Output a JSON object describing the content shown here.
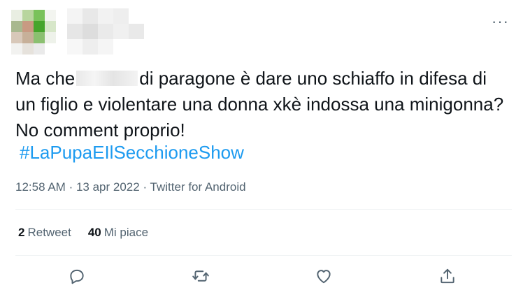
{
  "tweet": {
    "text_before": "Ma che",
    "text_after": "di paragone è dare uno schiaffo in difesa di un figlio e violentare una donna xkè indossa una minigonna? No comment proprio!",
    "hashtag": "#LaPupaEIlSecchioneShow",
    "time": "12:58 AM",
    "date": "13 apr 2022",
    "separator": "·",
    "source": "Twitter for Android",
    "more_label": "···"
  },
  "stats": {
    "retweets_count": "2",
    "retweets_label": "Retweet",
    "likes_count": "40",
    "likes_label": "Mi piace"
  },
  "icons": {
    "reply": "reply-icon",
    "retweet": "retweet-icon",
    "like": "like-icon",
    "share": "share-icon"
  },
  "colors": {
    "accent": "#1d9bf0",
    "secondary_text": "#536471",
    "text": "#0f1419"
  }
}
